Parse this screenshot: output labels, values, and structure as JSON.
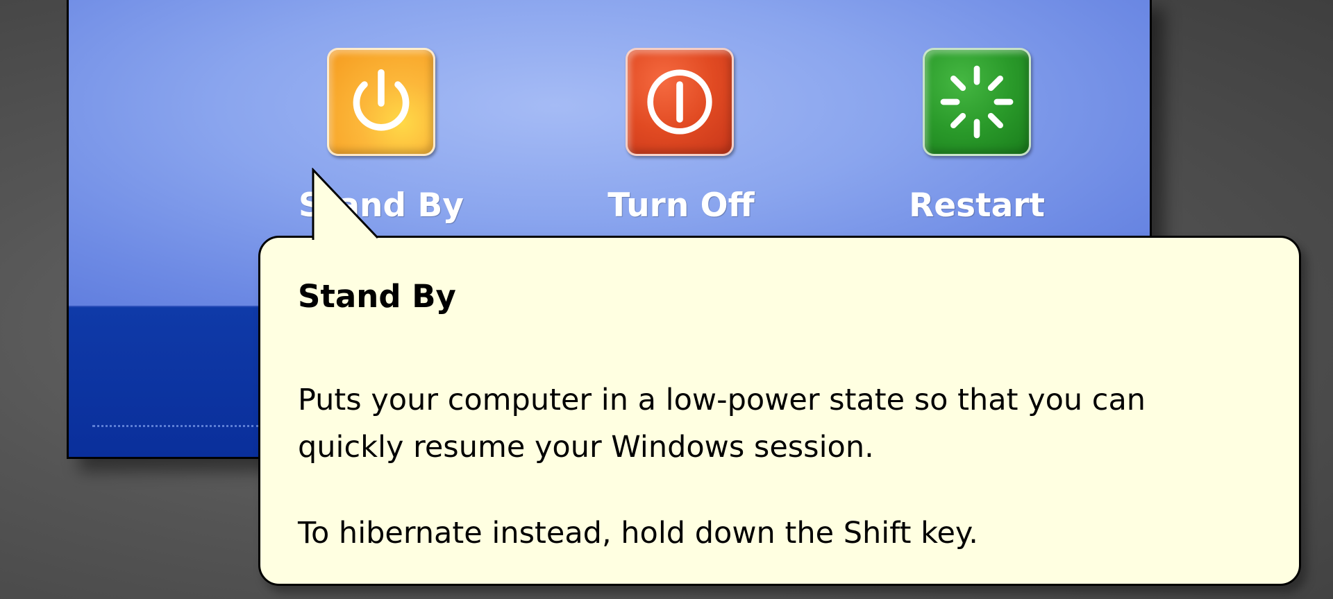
{
  "dialog": {
    "options": [
      {
        "label": "Stand By",
        "icon": "power-icon",
        "color": "#f7a928"
      },
      {
        "label": "Turn Off",
        "icon": "turn-off-icon",
        "color": "#d9401c"
      },
      {
        "label": "Restart",
        "icon": "restart-icon",
        "color": "#2a9a2a"
      }
    ],
    "panel_color": "#8aa5ee",
    "footer_color": "#0a2f9b"
  },
  "tooltip": {
    "title": "Stand By",
    "description_lines": [
      "Puts your computer in a low-power state so that you can",
      "quickly resume your Windows session."
    ],
    "hint": "To hibernate instead, hold down the Shift key.",
    "background_color": "#ffffe1"
  }
}
